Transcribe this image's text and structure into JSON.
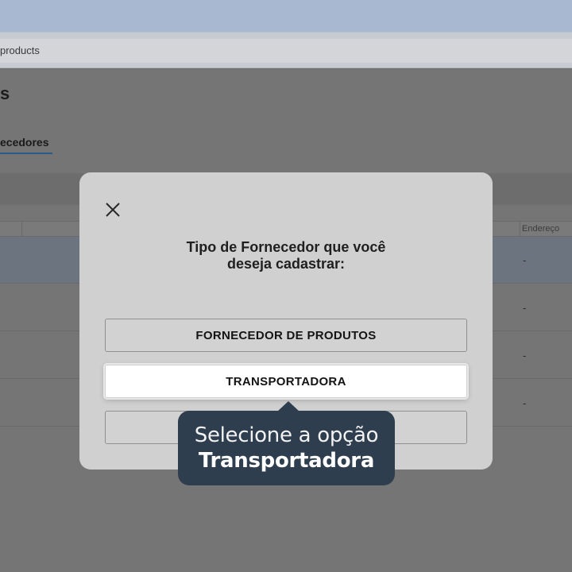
{
  "browser": {
    "address_text": "products"
  },
  "page": {
    "title_fragment": "s",
    "active_tab_fragment": "ecedores",
    "table": {
      "column_endereco": "Endereço",
      "rows": [
        {
          "endereco": "-"
        },
        {
          "endereco": "-"
        },
        {
          "endereco": "-"
        },
        {
          "endereco": "-"
        }
      ]
    }
  },
  "modal": {
    "title_line1": "Tipo de Fornecedor que você",
    "title_line2": "deseja cadastrar:",
    "close_icon": "close-icon",
    "options": [
      {
        "label": "FORNECEDOR DE PRODUTOS"
      },
      {
        "label": "TRANSPORTADORA"
      },
      {
        "label": ""
      }
    ]
  },
  "tooltip": {
    "line1": "Selecione a opção",
    "line2": "Transportadora",
    "background": "#2f3e4e"
  }
}
